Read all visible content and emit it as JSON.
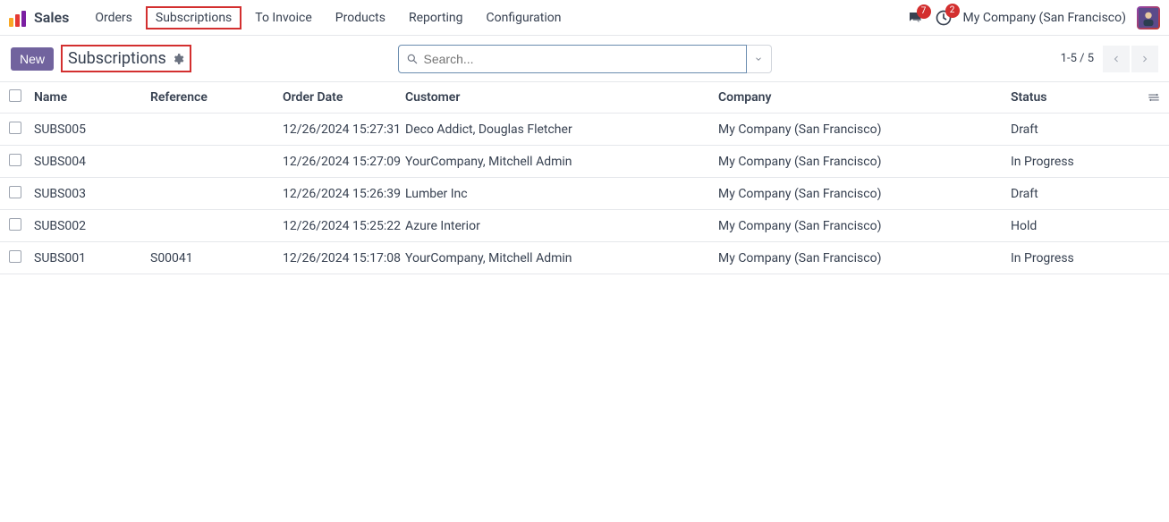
{
  "app_title": "Sales",
  "menu": [
    "Orders",
    "Subscriptions",
    "To Invoice",
    "Products",
    "Reporting",
    "Configuration"
  ],
  "menu_highlight_index": 1,
  "messages_badge": "7",
  "activities_badge": "2",
  "company": "My Company (San Francisco)",
  "new_button": "New",
  "breadcrumb": "Subscriptions",
  "search_placeholder": "Search...",
  "pager": "1-5 / 5",
  "columns": [
    "Name",
    "Reference",
    "Order Date",
    "Customer",
    "Company",
    "Status"
  ],
  "rows": [
    {
      "name": "SUBS005",
      "reference": "",
      "date": "12/26/2024 15:27:31",
      "customer": "Deco Addict, Douglas Fletcher",
      "company": "My Company (San Francisco)",
      "status": "Draft"
    },
    {
      "name": "SUBS004",
      "reference": "",
      "date": "12/26/2024 15:27:09",
      "customer": "YourCompany, Mitchell Admin",
      "company": "My Company (San Francisco)",
      "status": "In Progress"
    },
    {
      "name": "SUBS003",
      "reference": "",
      "date": "12/26/2024 15:26:39",
      "customer": "Lumber Inc",
      "company": "My Company (San Francisco)",
      "status": "Draft"
    },
    {
      "name": "SUBS002",
      "reference": "",
      "date": "12/26/2024 15:25:22",
      "customer": "Azure Interior",
      "company": "My Company (San Francisco)",
      "status": "Hold"
    },
    {
      "name": "SUBS001",
      "reference": "S00041",
      "date": "12/26/2024 15:17:08",
      "customer": "YourCompany, Mitchell Admin",
      "company": "My Company (San Francisco)",
      "status": "In Progress"
    }
  ]
}
